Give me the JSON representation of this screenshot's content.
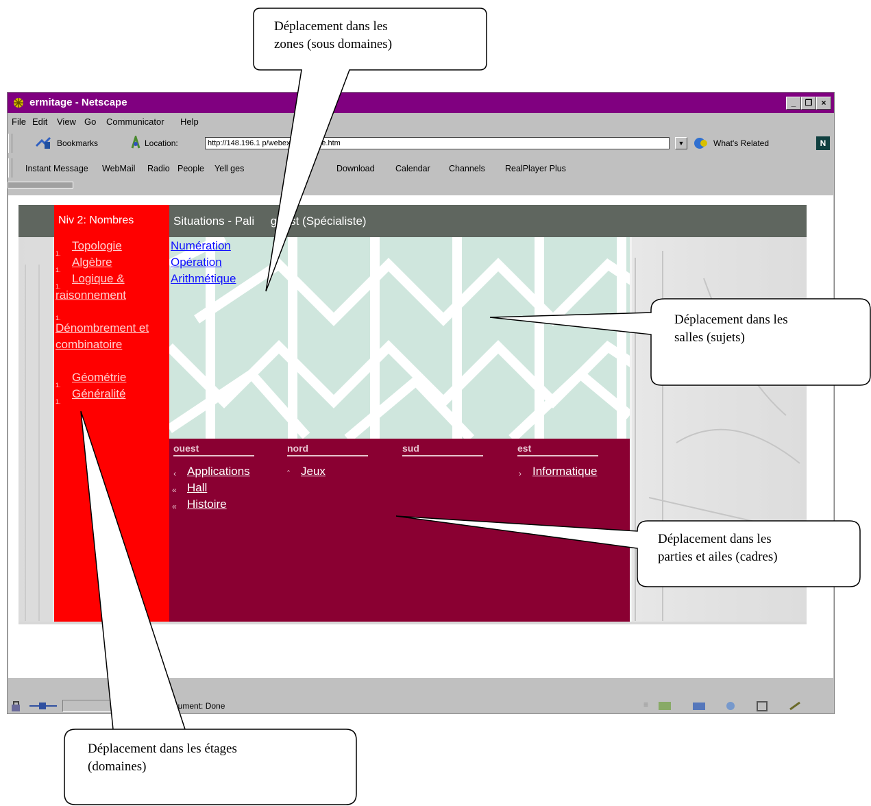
{
  "window": {
    "title": "ermitage - Netscape"
  },
  "menu": [
    "File",
    "Edit",
    "View",
    "Go",
    "Communicator",
    "Help"
  ],
  "nav": {
    "bookmarks": "Bookmarks",
    "location_label": "Location:",
    "url": "http://148.196.1  p/webexp/ermitage.htm",
    "whats_related": "What's Related"
  },
  "personal_toolbar": [
    "Instant Message",
    "WebMail",
    "Radio",
    "People",
    "Yell   ges",
    "Download",
    "Calendar",
    "Channels",
    "RealPlayer Plus"
  ],
  "page": {
    "level": "Niv 2: Nombres",
    "situation": "Situations - Pali     guest (Spécialiste)",
    "domains": [
      "Topologie",
      "Algèbre",
      "Logique & raisonnement",
      "Dénombrement et combinatoire",
      "Géométrie",
      "Généralité"
    ],
    "topics": [
      "Numération",
      "Opération",
      "Arithmétique"
    ],
    "directions": {
      "ouest": "ouest",
      "nord": "nord",
      "sud": "sud",
      "est": "est",
      "ouest_links": [
        "Applications",
        "Hall",
        "Histoire"
      ],
      "nord_links": [
        "Jeux"
      ],
      "est_links": [
        "Informatique"
      ]
    }
  },
  "status": {
    "text": "  cument: Done"
  },
  "callouts": {
    "zones": [
      "Déplacement dans les",
      "zones (sous domaines)"
    ],
    "salles": [
      "Déplacement dans les",
      "salles (sujets)"
    ],
    "parties": [
      "Déplacement dans les",
      "parties et ailes (cadres)"
    ],
    "etages": [
      "Déplacement dans les étages",
      "(domaines)"
    ]
  },
  "colors": {
    "titlebar": "#800080",
    "header": "#5f665f",
    "sidebar": "#ff0000",
    "frames": "#8a0032",
    "pattern": "#cfe6dd"
  }
}
